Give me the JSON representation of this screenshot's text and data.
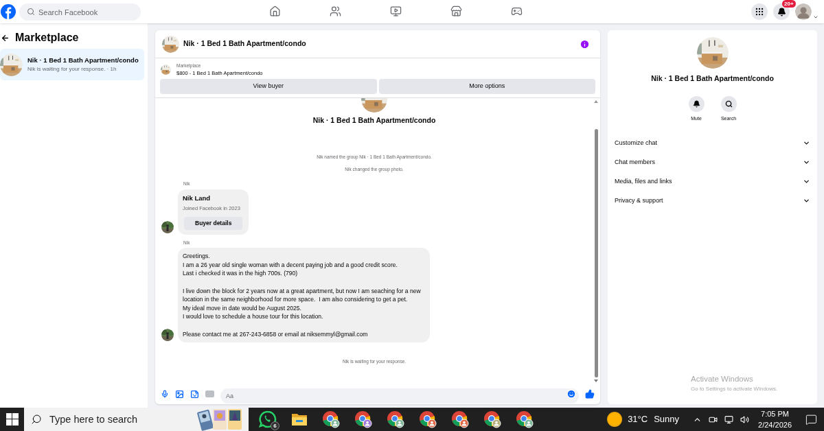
{
  "topbar": {
    "search": {
      "placeholder": "Search Facebook"
    },
    "nav": [
      {
        "kind": "home",
        "selected": false
      },
      {
        "kind": "friends",
        "selected": false
      },
      {
        "kind": "video",
        "selected": false
      },
      {
        "kind": "marketplace",
        "selected": false
      },
      {
        "kind": "gaming",
        "selected": false
      }
    ],
    "notifications_badge": "20+"
  },
  "sidebar": {
    "title": "Marketplace",
    "items": [
      {
        "title": "Nik · 1 Bed 1 Bath Apartment/condo",
        "subtitle": "Nik is waiting for your response. · 1h",
        "selected": true
      }
    ]
  },
  "chat": {
    "title": "Nik · 1 Bed 1 Bath Apartment/condo",
    "listing": {
      "label": "Marketplace",
      "title": "$800 - 1 Bed 1 Bath Apartment/condo"
    },
    "actions": [
      "View buyer",
      "More options"
    ],
    "group_title": "Nik · 1 Bed 1 Bath Apartment/condo",
    "events": [
      "Nik named the group Nik · 1 Bed 1 Bath Apartment/condo.",
      "Nik changed the group photo."
    ],
    "messages": [
      {
        "kind": "buyer_card",
        "sender": "Nik",
        "name": "Nik Land",
        "detail": "Joined Facebook in 2023",
        "button": "Buyer details"
      },
      {
        "kind": "text",
        "sender": "Nik",
        "text": "Greetings.\nI am a 26 year old single woman with a decent paying job and a good credit score.\nLast i checked it was in the high 700s. (790)\n\nI live down the block for 2 years now at a great apartment, but now I am seaching for a new location in the same neighborhood for more space.  I am also considering to get a pet.\nMy ideal move in date would be August 2025.\nI would love to schedule a house tour for this location.\n\nPlease contact me at 267-243-6858 or email at niksemmyl@gmail.com"
      }
    ],
    "footer_event": "Nik is waiting for your response.",
    "composer": {
      "placeholder": "Aa"
    }
  },
  "info_panel": {
    "title": "Nik · 1 Bed 1 Bath Apartment/condo",
    "actions": [
      {
        "kind": "mute",
        "label": "Mute"
      },
      {
        "kind": "search",
        "label": "Search"
      }
    ],
    "sections": [
      {
        "label": "Customize chat",
        "expanded": false
      },
      {
        "label": "Chat members",
        "expanded": false
      },
      {
        "label": "Media, files and links",
        "expanded": false
      },
      {
        "label": "Privacy & support",
        "expanded": false
      }
    ]
  },
  "activation_notice": {
    "title": "Activate Windows",
    "subtitle": "Go to Settings to activate Windows."
  },
  "taskbar": {
    "search": {
      "placeholder": "Type here to search"
    },
    "apps": [
      {
        "kind": "whatsapp",
        "badge": "6"
      },
      {
        "kind": "folder"
      },
      {
        "kind": "chrome",
        "color": "#7fb89a"
      },
      {
        "kind": "chrome",
        "color": "#a07ad8"
      },
      {
        "kind": "chrome",
        "color": "#7fb89a"
      },
      {
        "kind": "chrome",
        "color": "#e06a4a"
      },
      {
        "kind": "chrome",
        "color": "#e06a4a"
      },
      {
        "kind": "chrome",
        "color": "#b8b07a"
      },
      {
        "kind": "chrome",
        "color": "#7fb89a"
      }
    ],
    "weather": {
      "temp": "31°C",
      "condition": "Sunny"
    },
    "time": "7:05 PM",
    "date": "2/24/2026"
  }
}
